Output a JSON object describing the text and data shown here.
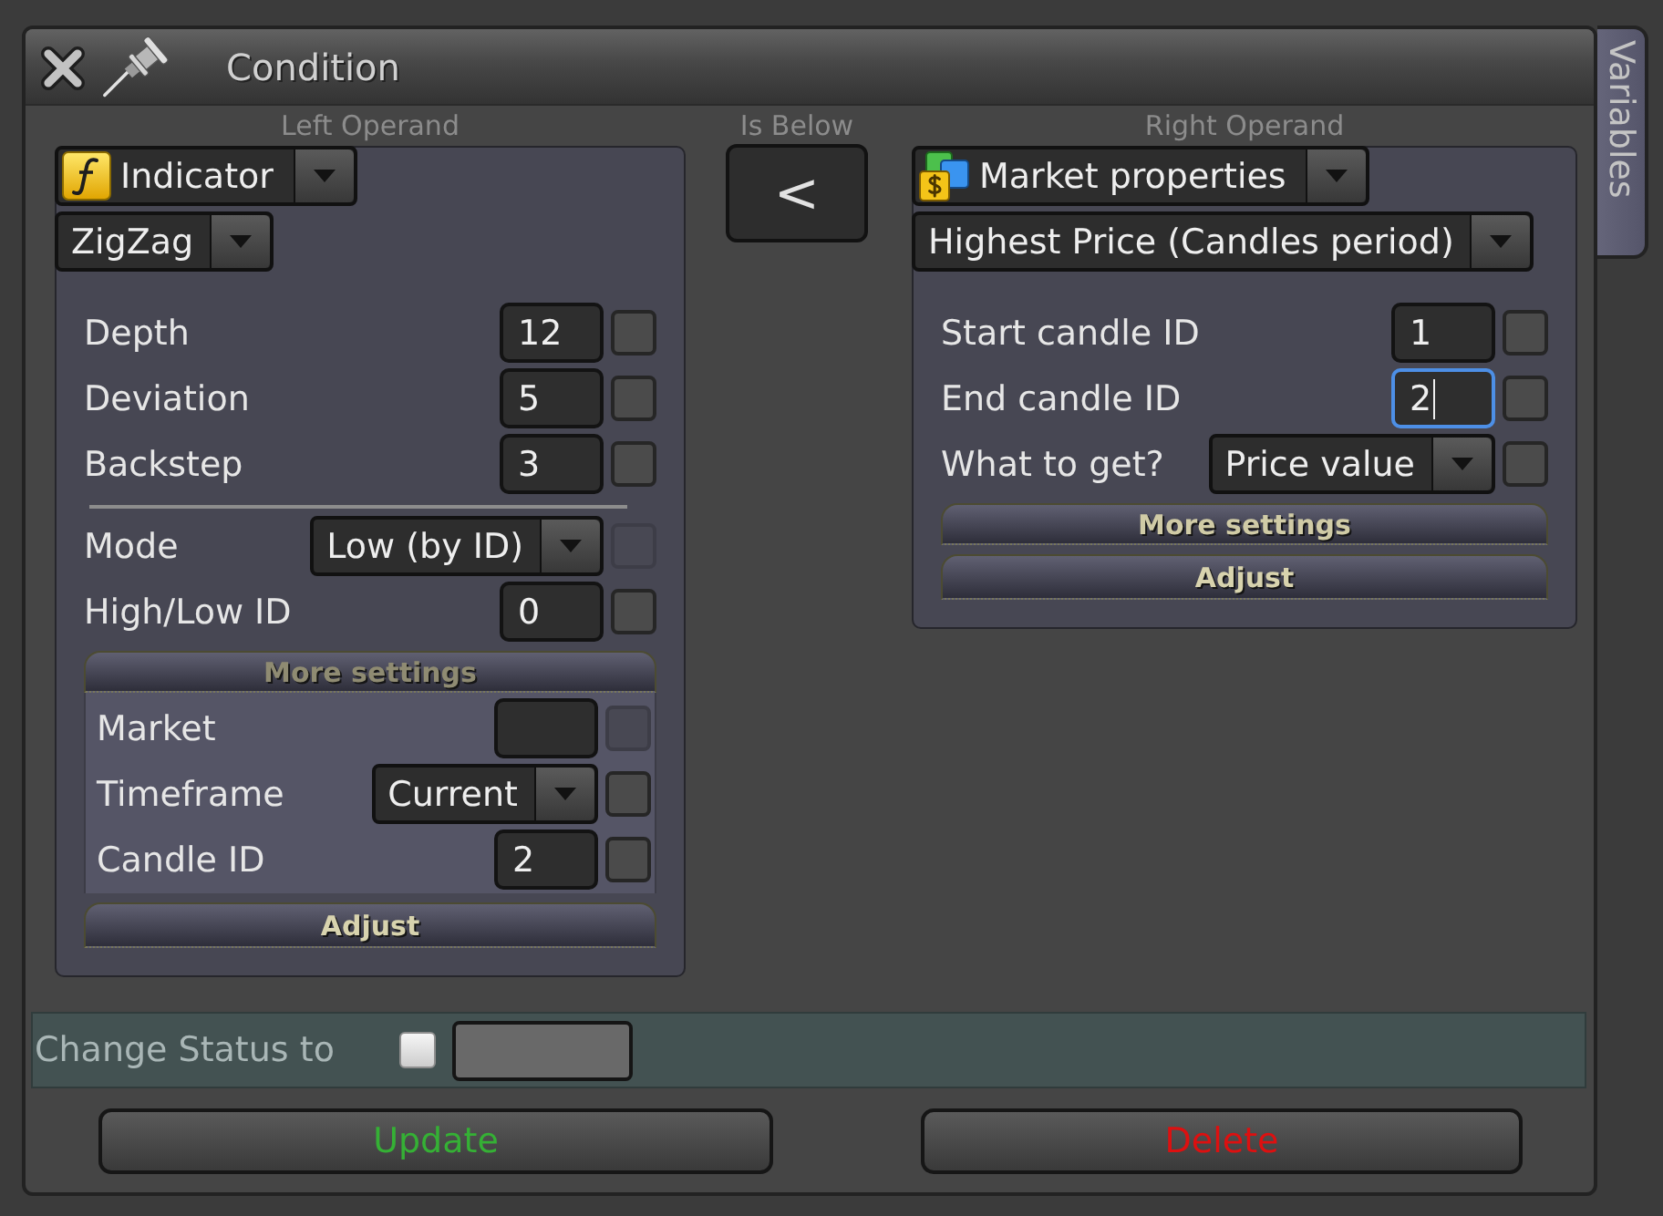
{
  "window": {
    "title": "Condition"
  },
  "side_tab": {
    "label": "Variables"
  },
  "left_operand": {
    "caption": "Left Operand",
    "type_select": {
      "kind": "indicator",
      "value": "Indicator"
    },
    "item_select": {
      "value": "ZigZag"
    },
    "param_groups": [
      {
        "params": [
          {
            "kind": "input",
            "label": "Depth",
            "value": "12",
            "focused": false,
            "checkbox": {
              "checked": false,
              "disabled": false
            }
          },
          {
            "kind": "input",
            "label": "Deviation",
            "value": "5",
            "focused": false,
            "checkbox": {
              "checked": false,
              "disabled": false
            }
          },
          {
            "kind": "input",
            "label": "Backstep",
            "value": "3",
            "focused": false,
            "checkbox": {
              "checked": false,
              "disabled": false
            }
          }
        ]
      },
      {
        "params": [
          {
            "kind": "select",
            "label": "Mode",
            "value": "Low (by ID)",
            "focused": false,
            "checkbox": {
              "checked": false,
              "disabled": true
            }
          },
          {
            "kind": "input",
            "label": "High/Low ID",
            "value": "0",
            "focused": false,
            "checkbox": {
              "checked": false,
              "disabled": false
            }
          }
        ]
      }
    ],
    "more_settings": {
      "label": "More settings",
      "expanded": true,
      "params": [
        {
          "kind": "input",
          "label": "Market",
          "focused": false,
          "checkbox": {
            "checked": false,
            "disabled": true
          }
        },
        {
          "kind": "select",
          "label": "Timeframe",
          "value": "Current",
          "focused": false,
          "checkbox": {
            "checked": false,
            "disabled": false
          }
        },
        {
          "kind": "input",
          "label": "Candle ID",
          "value": "2",
          "focused": false,
          "checkbox": {
            "checked": false,
            "disabled": false
          }
        }
      ]
    },
    "adjust_button": {
      "label": "Adjust"
    }
  },
  "operator": {
    "caption": "Is Below",
    "button": {
      "label": "<"
    }
  },
  "right_operand": {
    "caption": "Right Operand",
    "type_select": {
      "kind": "market",
      "value": "Market properties"
    },
    "item_select": {
      "value": "Highest Price (Candles period)"
    },
    "param_groups": [
      {
        "params": [
          {
            "kind": "input",
            "label": "Start candle ID",
            "value": "1",
            "focused": false,
            "checkbox": {
              "checked": false,
              "disabled": false
            }
          },
          {
            "kind": "input",
            "label": "End candle ID",
            "value": "2",
            "focused": true,
            "checkbox": {
              "checked": false,
              "disabled": false
            }
          },
          {
            "kind": "select",
            "label": "What to get?",
            "value": "Price value",
            "focused": false,
            "checkbox": {
              "checked": false,
              "disabled": false
            }
          }
        ]
      }
    ],
    "more_settings": {
      "label": "More settings",
      "expanded": false
    },
    "adjust_button": {
      "label": "Adjust"
    }
  },
  "status_row": {
    "label": "Change Status to",
    "checkbox": {
      "checked": false
    }
  },
  "buttons": [
    {
      "kind": "update",
      "label": "Update"
    },
    {
      "kind": "delete",
      "label": "Delete"
    }
  ]
}
